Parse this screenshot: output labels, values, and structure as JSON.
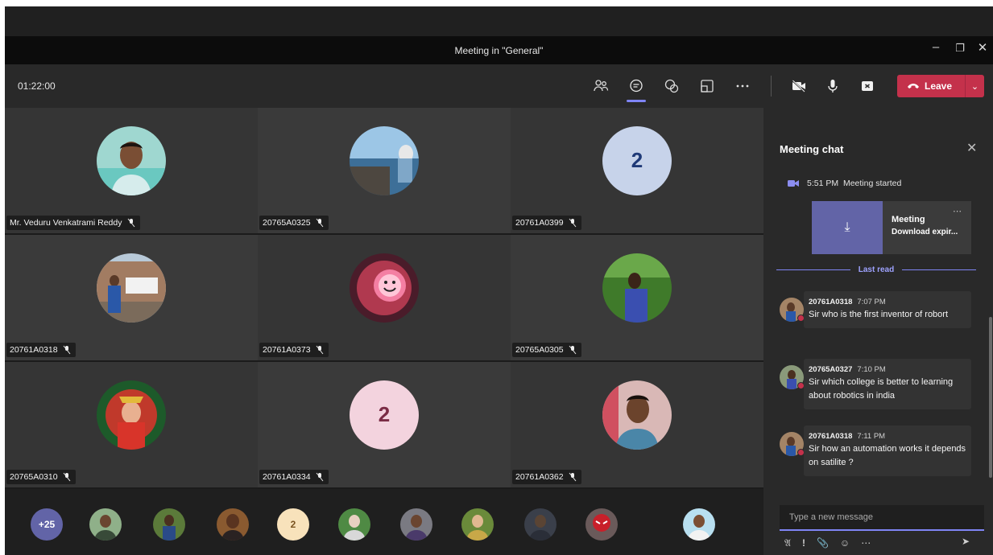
{
  "window": {
    "title": "Meeting in \"General\""
  },
  "toolbar": {
    "timer": "01:22:00",
    "leave_label": "Leave",
    "icons": [
      "participants-icon",
      "chat-icon",
      "reactions-icon",
      "share-tray-icon",
      "more-options-icon",
      "camera-off-icon",
      "mic-icon",
      "share-screen-icon"
    ]
  },
  "colors": {
    "accent": "#7f85f5",
    "leave": "#c4314b",
    "card": "#6264a7"
  },
  "tiles": [
    {
      "name": "Mr. Veduru Venkatrami Reddy",
      "avatar": "photo"
    },
    {
      "name": "20765A0325",
      "avatar": "photo"
    },
    {
      "name": "20761A0399",
      "avatar": "initial",
      "initial": "2",
      "bg": "#c7d3ea",
      "fg": "#1f3a78"
    },
    {
      "name": "20761A0318",
      "avatar": "photo"
    },
    {
      "name": "20761A0373",
      "avatar": "photo"
    },
    {
      "name": "20765A0305",
      "avatar": "photo"
    },
    {
      "name": "20765A0310",
      "avatar": "photo"
    },
    {
      "name": "20761A0334",
      "avatar": "initial",
      "initial": "2",
      "bg": "#f3d3de",
      "fg": "#7a2c45"
    },
    {
      "name": "20761A0362",
      "avatar": "photo"
    }
  ],
  "strip": {
    "overflow_count": "+25",
    "initial_avatar": "2"
  },
  "chat": {
    "title": "Meeting chat",
    "started_time": "5:51 PM",
    "started_text": "Meeting started",
    "card_title": "Meeting",
    "card_subtitle": "Download expir...",
    "last_read": "Last read",
    "messages": [
      {
        "author": "20761A0318",
        "time": "7:07 PM",
        "text": "Sir who is the first inventor of robort"
      },
      {
        "author": "20765A0327",
        "time": "7:10 PM",
        "text": "Sir which college is better to learning about robotics in india"
      },
      {
        "author": "20761A0318",
        "time": "7:11 PM",
        "text": "Sir how an automation works it depends on satilite ?"
      }
    ],
    "compose_placeholder": "Type a new message"
  }
}
